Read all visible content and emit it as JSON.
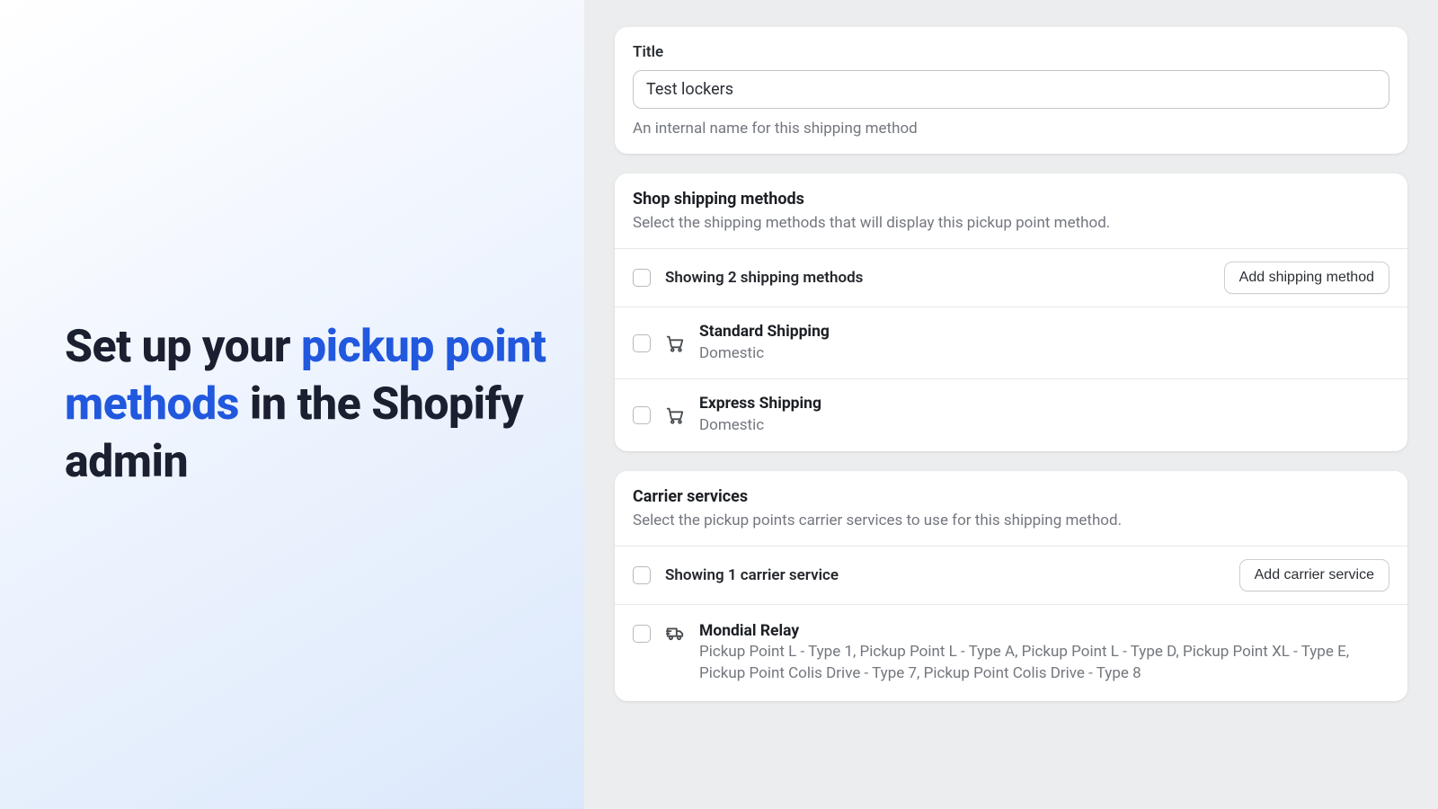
{
  "headline": {
    "prefix": "Set up your ",
    "highlight": "pickup point methods",
    "suffix": " in the Shopify admin"
  },
  "title_card": {
    "label": "Title",
    "value": "Test lockers",
    "help": "An internal name for this shipping method"
  },
  "shipping": {
    "heading": "Shop shipping methods",
    "subheading": "Select the shipping methods that will display this pickup point method.",
    "summary": "Showing 2 shipping methods",
    "add_label": "Add shipping method",
    "items": [
      {
        "name": "Standard Shipping",
        "scope": "Domestic"
      },
      {
        "name": "Express Shipping",
        "scope": "Domestic"
      }
    ]
  },
  "carrier": {
    "heading": "Carrier services",
    "subheading": "Select the pickup points carrier services to use for this shipping method.",
    "summary": "Showing 1 carrier service",
    "add_label": "Add carrier service",
    "items": [
      {
        "name": "Mondial Relay",
        "detail": "Pickup Point L - Type 1, Pickup Point L - Type A, Pickup Point L - Type D, Pickup Point XL - Type E, Pickup Point Colis Drive - Type 7, Pickup Point Colis Drive - Type 8"
      }
    ]
  }
}
